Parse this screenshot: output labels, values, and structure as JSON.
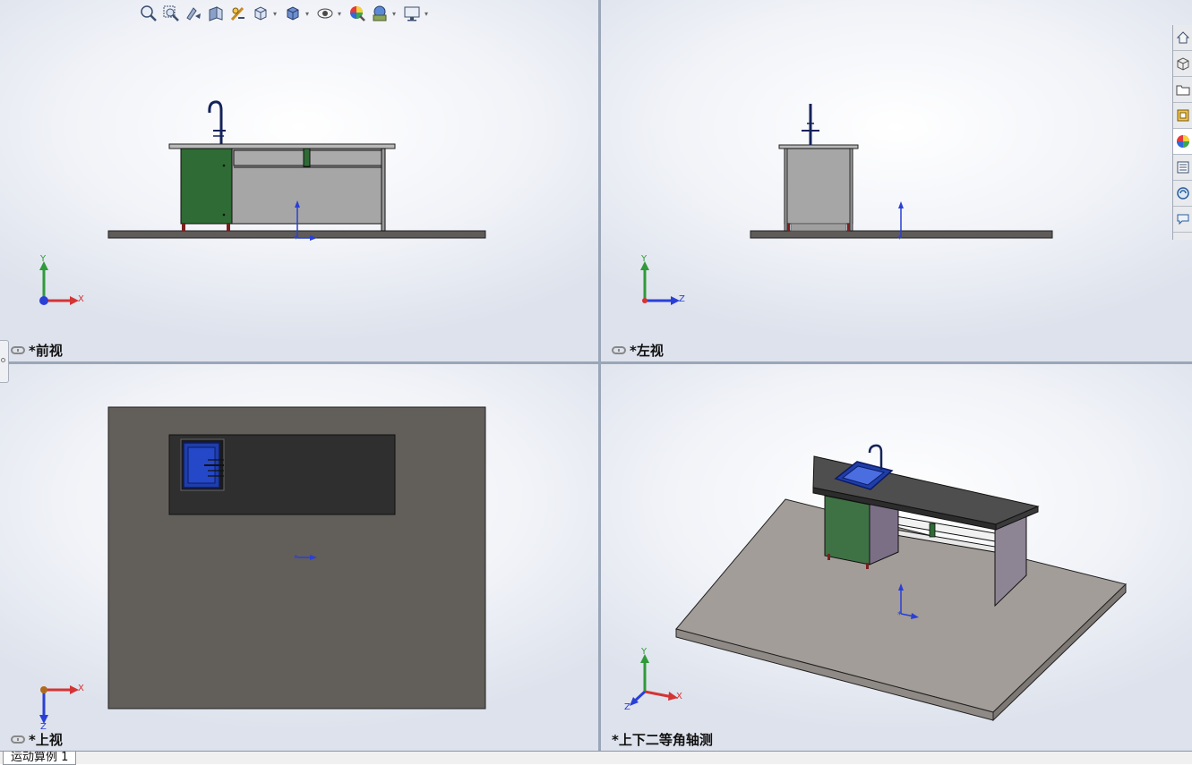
{
  "views": {
    "front": "*前视",
    "left": "*左视",
    "top": "*上视",
    "iso": "*上下二等角轴测"
  },
  "axes": {
    "x": "X",
    "y": "Y",
    "z": "Z"
  },
  "bottom_tabs": {
    "motion_study": "运动算例 1"
  },
  "toolbar": {
    "icons": [
      "zoom-to-fit-icon",
      "zoom-to-area-icon",
      "previous-view-icon",
      "section-view-icon",
      "dynamic-annotation-icon",
      "view-orientation-icon",
      "display-style-icon",
      "hide-show-items-icon",
      "edit-appearance-icon",
      "apply-scene-icon",
      "view-settings-icon"
    ]
  },
  "taskpane": {
    "icons": [
      "home-icon",
      "resources-icon",
      "design-library-icon",
      "file-explorer-icon",
      "appearances-icon",
      "custom-properties-icon",
      "forum-icon",
      "feedback-icon"
    ]
  },
  "colors": {
    "cabinet_green": "#2f6b35",
    "floor_dark": "#5f5b58",
    "floor_light": "#a29d98",
    "sink_blue": "#1f3ea8",
    "panel_gray": "#a6a6a6",
    "axis_x": "#d43434",
    "axis_y": "#2f9a3a",
    "axis_z": "#2a3fd6"
  }
}
